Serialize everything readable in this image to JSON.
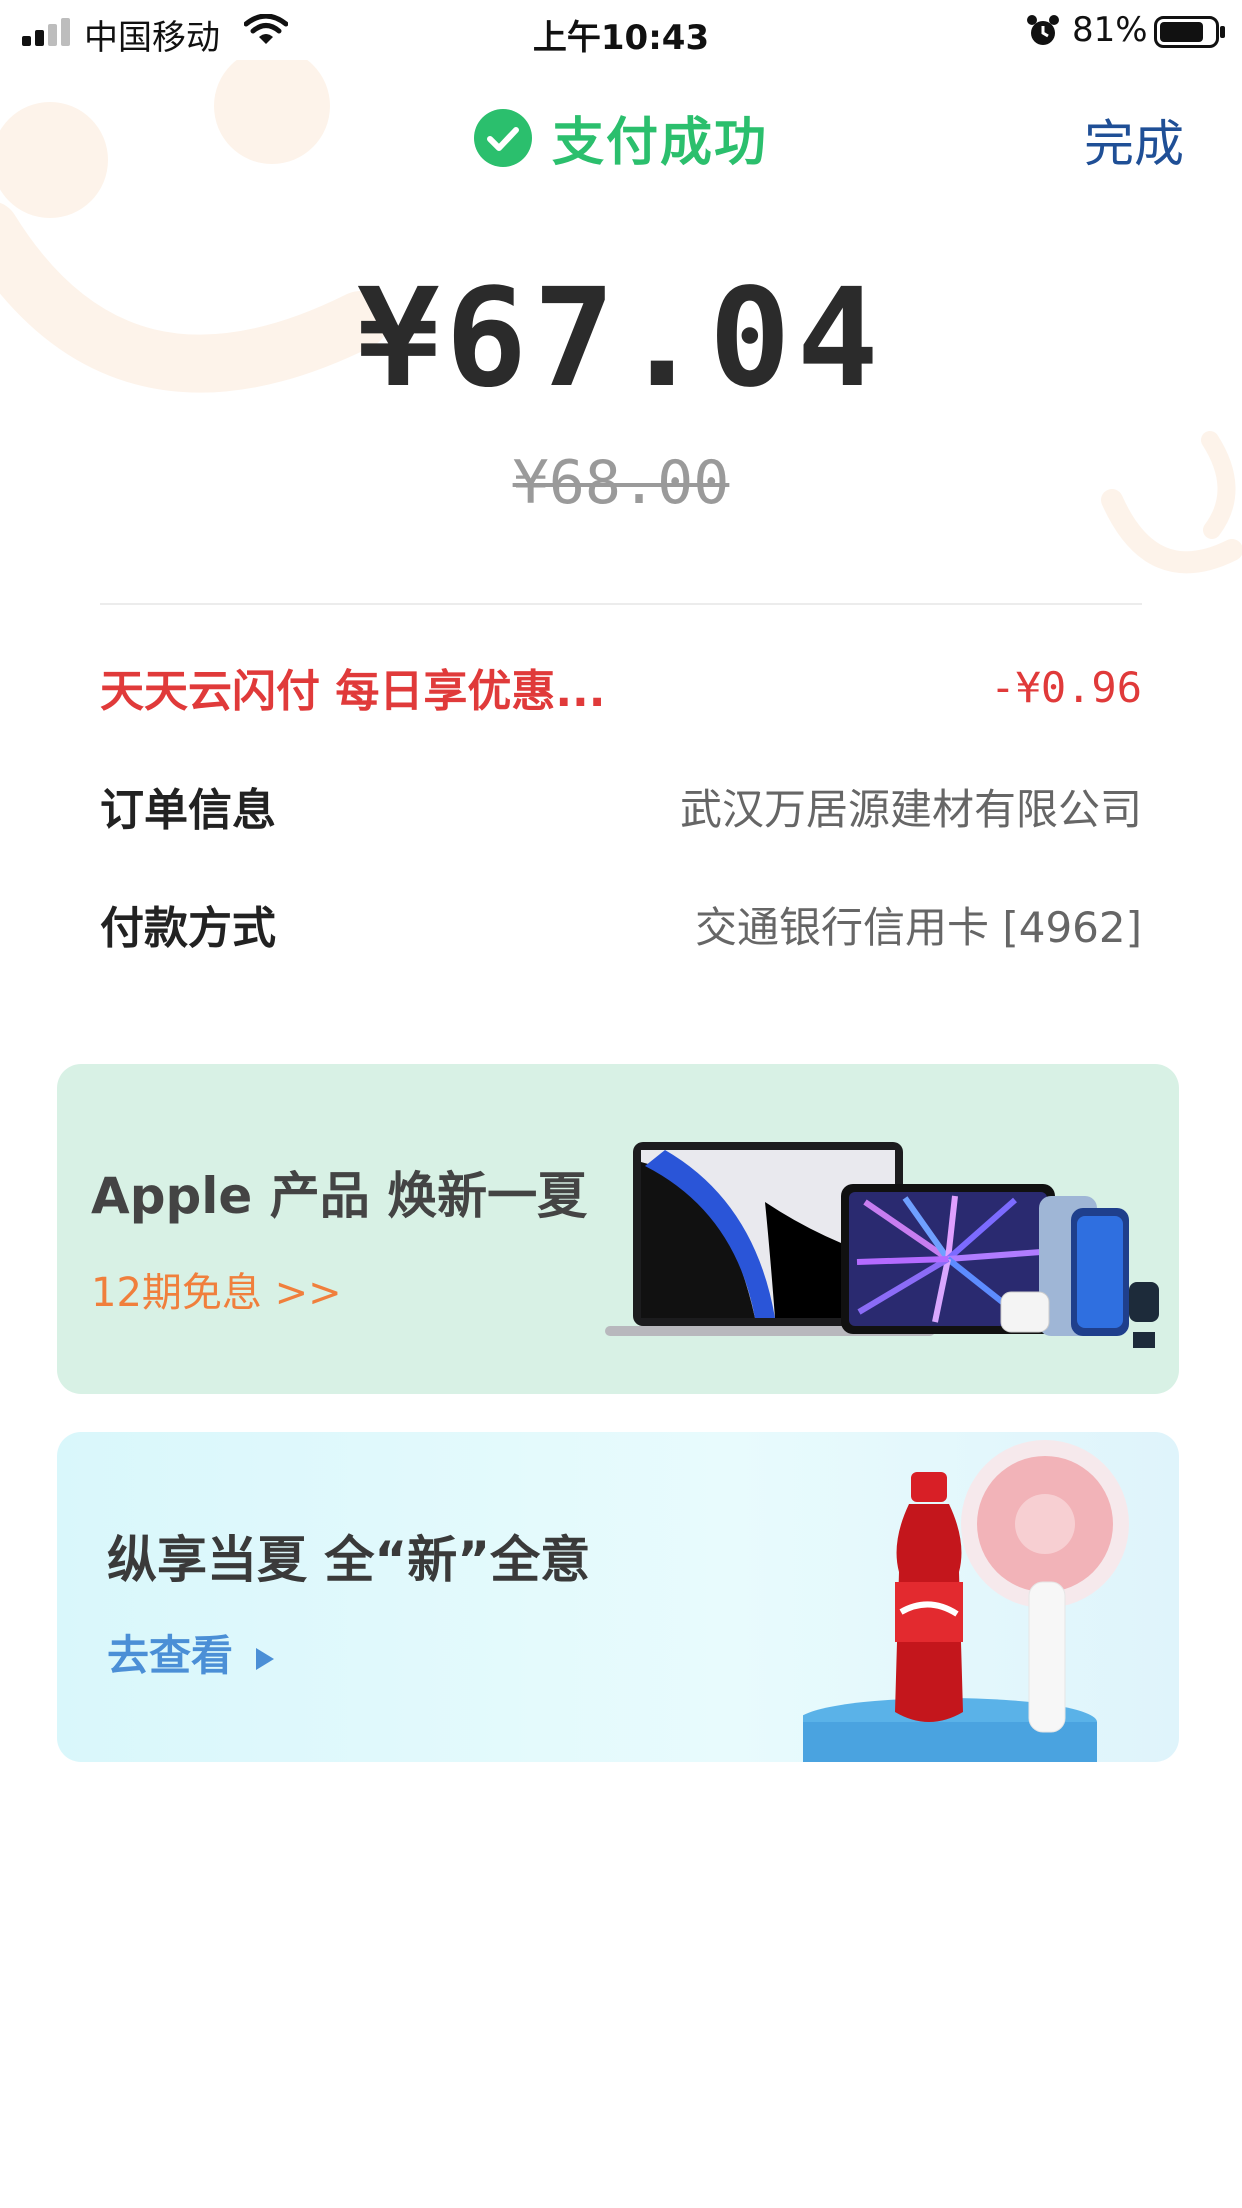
{
  "status_bar": {
    "carrier": "中国移动",
    "time": "上午10:43",
    "battery_percent": "81%",
    "battery_level": 0.81
  },
  "header": {
    "status_text": "支付成功",
    "done_label": "完成"
  },
  "payment": {
    "amount": "¥67.04",
    "original_amount": "¥68.00"
  },
  "details": {
    "promo": {
      "label": "天天云闪付  每日享优惠...",
      "value": "-¥0.96"
    },
    "order": {
      "label": "订单信息",
      "value": "武汉万居源建材有限公司"
    },
    "method": {
      "label": "付款方式",
      "value": "交通银行信用卡 [4962]"
    }
  },
  "banners": {
    "apple": {
      "title": "Apple 产品 焕新一夏",
      "subtitle": "12期免息 >>"
    },
    "summer": {
      "title": "纵享当夏 全“新”全意",
      "link": "去查看"
    }
  },
  "colors": {
    "success": "#2bbf6d",
    "done": "#1f4f96",
    "promo": "#e03a3a",
    "apple_banner_bg": "#d8f1e5",
    "apple_subtitle": "#f07f3c",
    "summer_link": "#4b8fd6"
  },
  "icons": {
    "signal": "signal-icon",
    "wifi": "wifi-icon",
    "alarm": "alarm-icon",
    "battery": "battery-icon",
    "success": "check-circle-icon",
    "link_arrow": "play-arrow-icon"
  }
}
